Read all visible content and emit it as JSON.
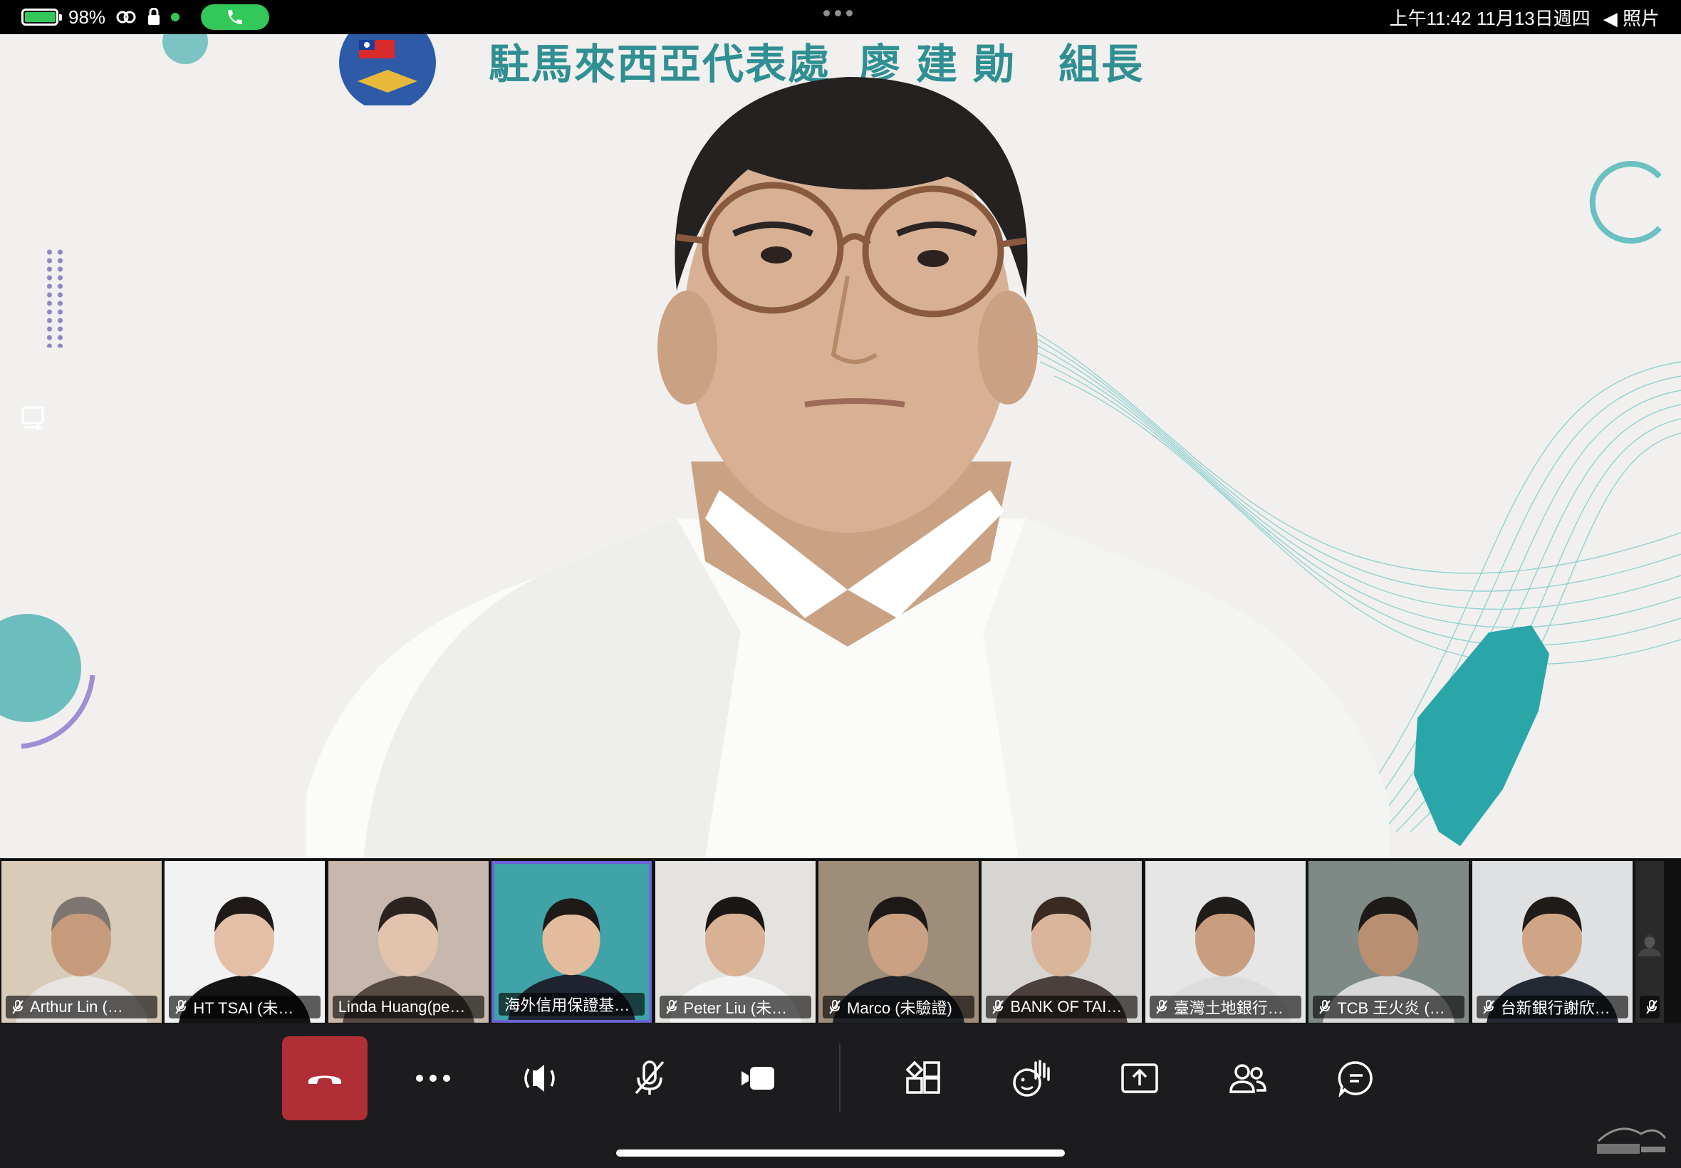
{
  "status_bar": {
    "battery": "98%",
    "battery_level": 0.98,
    "datetime": "上午11:42  11月13日週四",
    "right_label": "照片"
  },
  "main_video": {
    "banner_org": "駐馬來西亞代表處",
    "banner_name": "廖建勛",
    "banner_title": "組長"
  },
  "participants": [
    {
      "name": "Arthur Lin (…",
      "muted": true
    },
    {
      "name": "HT TSAI (未…",
      "muted": true
    },
    {
      "name": "Linda Huang(pe…",
      "muted": false
    },
    {
      "name": "海外信用保證基…",
      "muted": false,
      "active": true
    },
    {
      "name": "Peter Liu (未…",
      "muted": true
    },
    {
      "name": "Marco (未驗證)",
      "muted": true
    },
    {
      "name": "BANK OF TAI…",
      "muted": true
    },
    {
      "name": "臺灣土地銀行…",
      "muted": true
    },
    {
      "name": "TCB 王火炎 (…",
      "muted": true
    },
    {
      "name": "台新銀行謝欣…",
      "muted": true
    },
    {
      "name": "…",
      "muted": true
    }
  ],
  "toolbar": {
    "buttons": [
      "hang-up",
      "more",
      "audio",
      "mic-muted",
      "camera",
      "view",
      "react",
      "share",
      "people",
      "chat"
    ]
  },
  "colors": {
    "hangup": "#b02e35",
    "status_green": "#34c759",
    "active_border": "#6b66d6",
    "banner_teal": "#2f8f93"
  }
}
